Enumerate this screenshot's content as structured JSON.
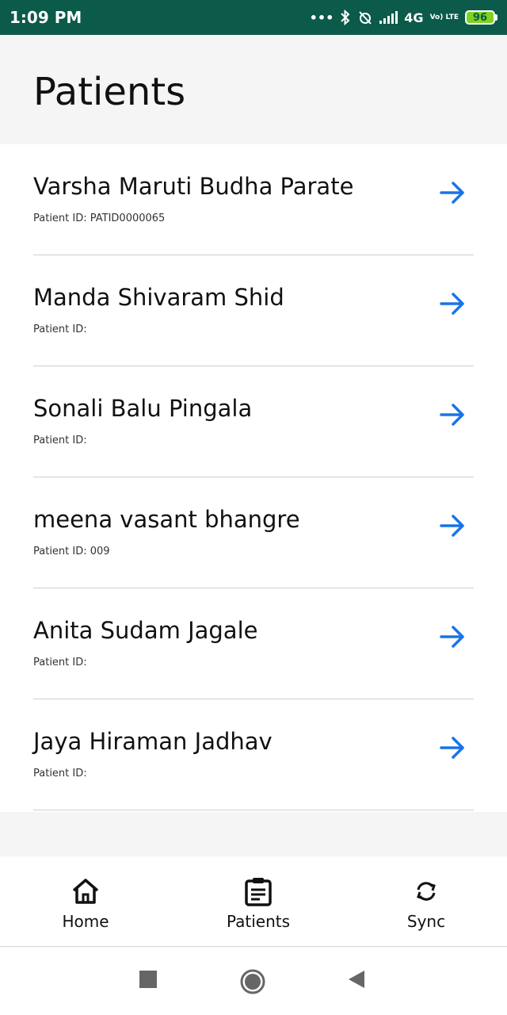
{
  "status_bar": {
    "time": "1:09 PM",
    "network": "4G",
    "volte": "Vo) LTE",
    "battery": "96"
  },
  "header": {
    "title": "Patients"
  },
  "patients": [
    {
      "name": "Varsha Maruti Budha Parate",
      "id_text": "Patient ID: PATID0000065"
    },
    {
      "name": "Manda Shivaram Shid",
      "id_text": "Patient ID:"
    },
    {
      "name": "Sonali Balu Pingala",
      "id_text": "Patient ID:"
    },
    {
      "name": "meena vasant bhangre",
      "id_text": "Patient ID: 009"
    },
    {
      "name": "Anita Sudam Jagale",
      "id_text": "Patient ID:"
    },
    {
      "name": "Jaya Hiraman Jadhav",
      "id_text": "Patient ID:"
    }
  ],
  "bottom_nav": {
    "home_label": "Home",
    "patients_label": "Patients",
    "sync_label": "Sync"
  },
  "colors": {
    "status_bar": "#0b5a4a",
    "accent_arrow": "#1a73e8",
    "battery": "#7ed321"
  },
  "icons": [
    "bluetooth-icon",
    "alarm-off-icon",
    "signal-icon",
    "battery-icon",
    "arrow-right-icon",
    "home-icon",
    "clipboard-icon",
    "sync-icon",
    "square-icon",
    "circle-icon",
    "back-triangle-icon"
  ]
}
